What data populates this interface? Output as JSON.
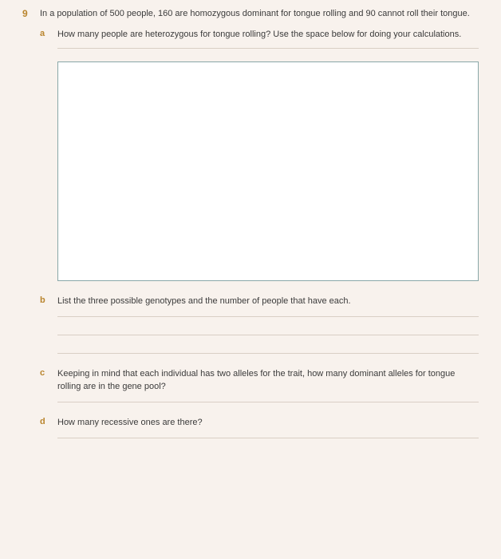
{
  "question": {
    "number": "9",
    "text": "In a population of 500 people, 160 are homozygous dominant for tongue rolling and 90 cannot roll their tongue.",
    "parts": [
      {
        "letter": "a",
        "text": "How many people are heterozygous for tongue rolling? Use the space below for doing your calculations."
      },
      {
        "letter": "b",
        "text": "List the three possible genotypes and the number of people that have each."
      },
      {
        "letter": "c",
        "text": "Keeping in mind that each individual has two alleles for the trait, how many dominant alleles for tongue rolling are in the gene pool?"
      },
      {
        "letter": "d",
        "text": "How many recessive ones are there?"
      }
    ]
  }
}
